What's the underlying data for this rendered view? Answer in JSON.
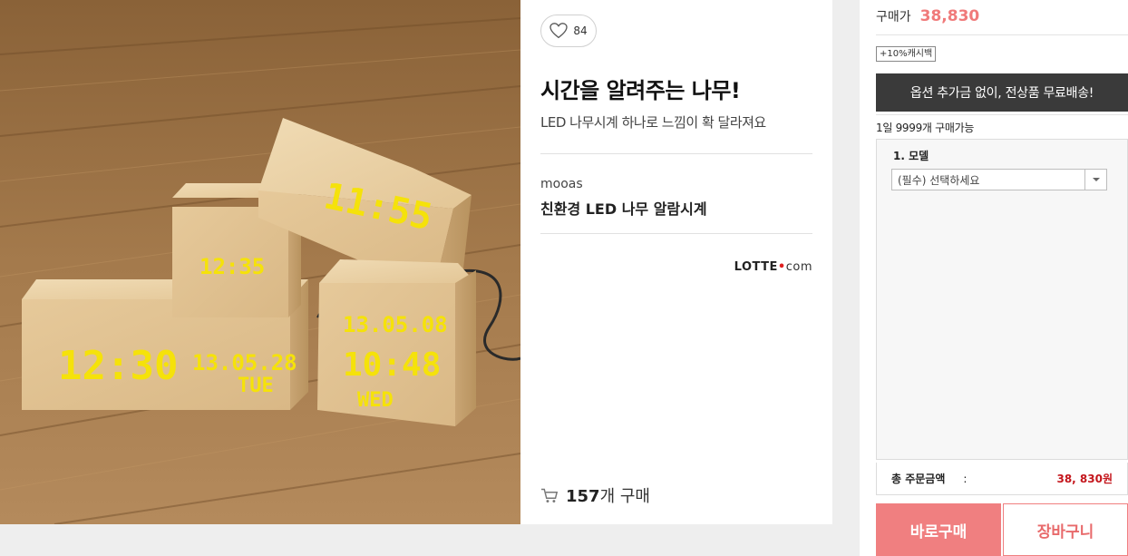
{
  "info": {
    "like_count": "84",
    "title": "시간을 알려주는 나무!",
    "subtitle": "LED 나무시계 하나로 느낌이 확 달라져요",
    "brand": "mooas",
    "product_name": "친환경 LED 나무 알람시계",
    "seller_logo": {
      "part1": "LOTTE",
      "dot": "•",
      "part2": "com"
    },
    "purchase": {
      "count": "157",
      "unit": "개 구매"
    }
  },
  "clock_faces": {
    "big_left_time": "12:30",
    "big_left_date": "13.05.28",
    "big_left_day": "TUE",
    "small_cube_time": "12:35",
    "top_time": "11:55",
    "right_date": "13.05.08",
    "right_time": "10:48",
    "right_day": "WED"
  },
  "order": {
    "price_label": "구매가",
    "price_value": "38,830",
    "cashback": "+10%캐시백",
    "free_shipping": "옵션 추가금 없이, 전상품 무료배송!",
    "limit": "1일 9999개 구매가능",
    "option_label": "1. 모델",
    "option_select_text": "(필수) 선택하세요",
    "total_label": "총 주문금액",
    "total_colon": ":",
    "total_value": "38, 830원",
    "buy_label": "바로구매",
    "cart_label": "장바구니"
  },
  "colors": {
    "accent": "#f07f80",
    "price": "#f07a7a",
    "total": "#c4161c",
    "led": "#f5e20a"
  }
}
